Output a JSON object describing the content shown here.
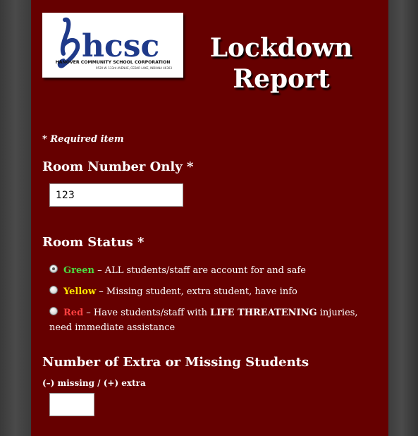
{
  "logo": {
    "letters": "hcsc",
    "org_name": "HANOVER COMMUNITY SCHOOL CORPORATION",
    "address": "9520 W. 133rd AVENUE, CEDAR LAKE, INDIANA 46303",
    "colors": {
      "letters": "#1f3a8a",
      "text": "#111111"
    }
  },
  "title": {
    "line1": "Lockdown",
    "line2": "Report"
  },
  "required_note": "* Required item",
  "room_number": {
    "label": "Room Number Only *",
    "value": "123"
  },
  "room_status": {
    "label": "Room Status *",
    "selected": "Green",
    "options": [
      {
        "color_name": "Green",
        "color": "#4ade42",
        "description": " – ALL students/staff are account for and safe",
        "checked": true
      },
      {
        "color_name": "Yellow",
        "color": "#ffe400",
        "description": " – Missing student, extra student, have info",
        "checked": false
      },
      {
        "color_name": "Red",
        "color": "#ff4040",
        "description_before": " – Have students/staff with ",
        "description_bold": "LIFE THREATENING",
        "description_after": " injuries, need immediate assistance",
        "checked": false
      }
    ]
  },
  "extra_missing": {
    "label": "Number of Extra or Missing Students",
    "hint": "(–) missing / (+) extra",
    "value": ""
  },
  "theme": {
    "panel_background": "#660000",
    "page_background": "#3c3c3c"
  }
}
